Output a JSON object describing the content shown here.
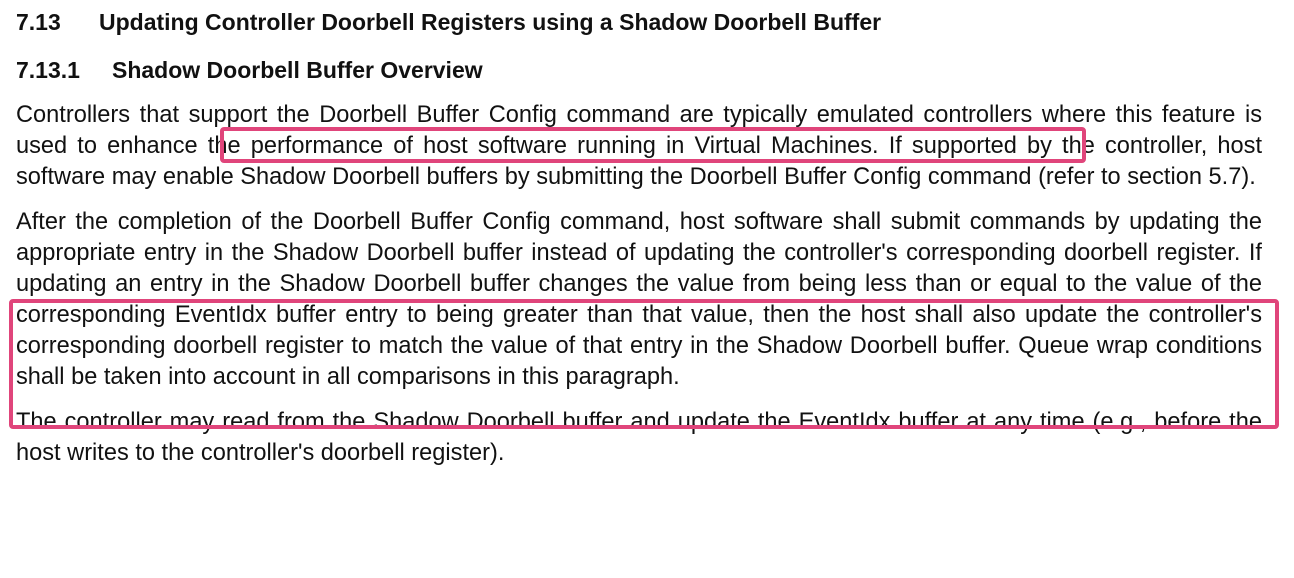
{
  "section": {
    "number": "7.13",
    "title": "Updating Controller Doorbell Registers using a Shadow Doorbell Buffer"
  },
  "subsection": {
    "number": "7.13.1",
    "title": "Shadow Doorbell Buffer Overview"
  },
  "paragraphs": [
    {
      "before": "Controllers that support the Doorbell Buffer Config command are typically emulated controllers where this feature is used to ",
      "highlight": "enhance the performance of host software running in Virtual Machines.",
      "after": " If supported by the controller, host software may enable Shadow Doorbell buffers by submitting the Doorbell Buffer Config command (refer to section 5.7)."
    },
    {
      "text": "After the completion of the Doorbell Buffer Config command, host software shall submit commands by updating the appropriate entry in the Shadow Doorbell buffer instead of updating the controller's corresponding doorbell register. If updating an entry in the Shadow Doorbell buffer changes the value from being less than or equal to the value of the corresponding EventIdx buffer entry to being greater than that value, then the host shall also update the controller's corresponding doorbell register to match the value of that entry in the Shadow Doorbell buffer. Queue wrap conditions shall be taken into account in all comparisons in this paragraph."
    },
    {
      "text": "The controller may read from the Shadow Doorbell buffer and update the EventIdx buffer at any time (e.g., before the host writes to the controller's doorbell register)."
    }
  ],
  "highlight_color": "#e0457b"
}
